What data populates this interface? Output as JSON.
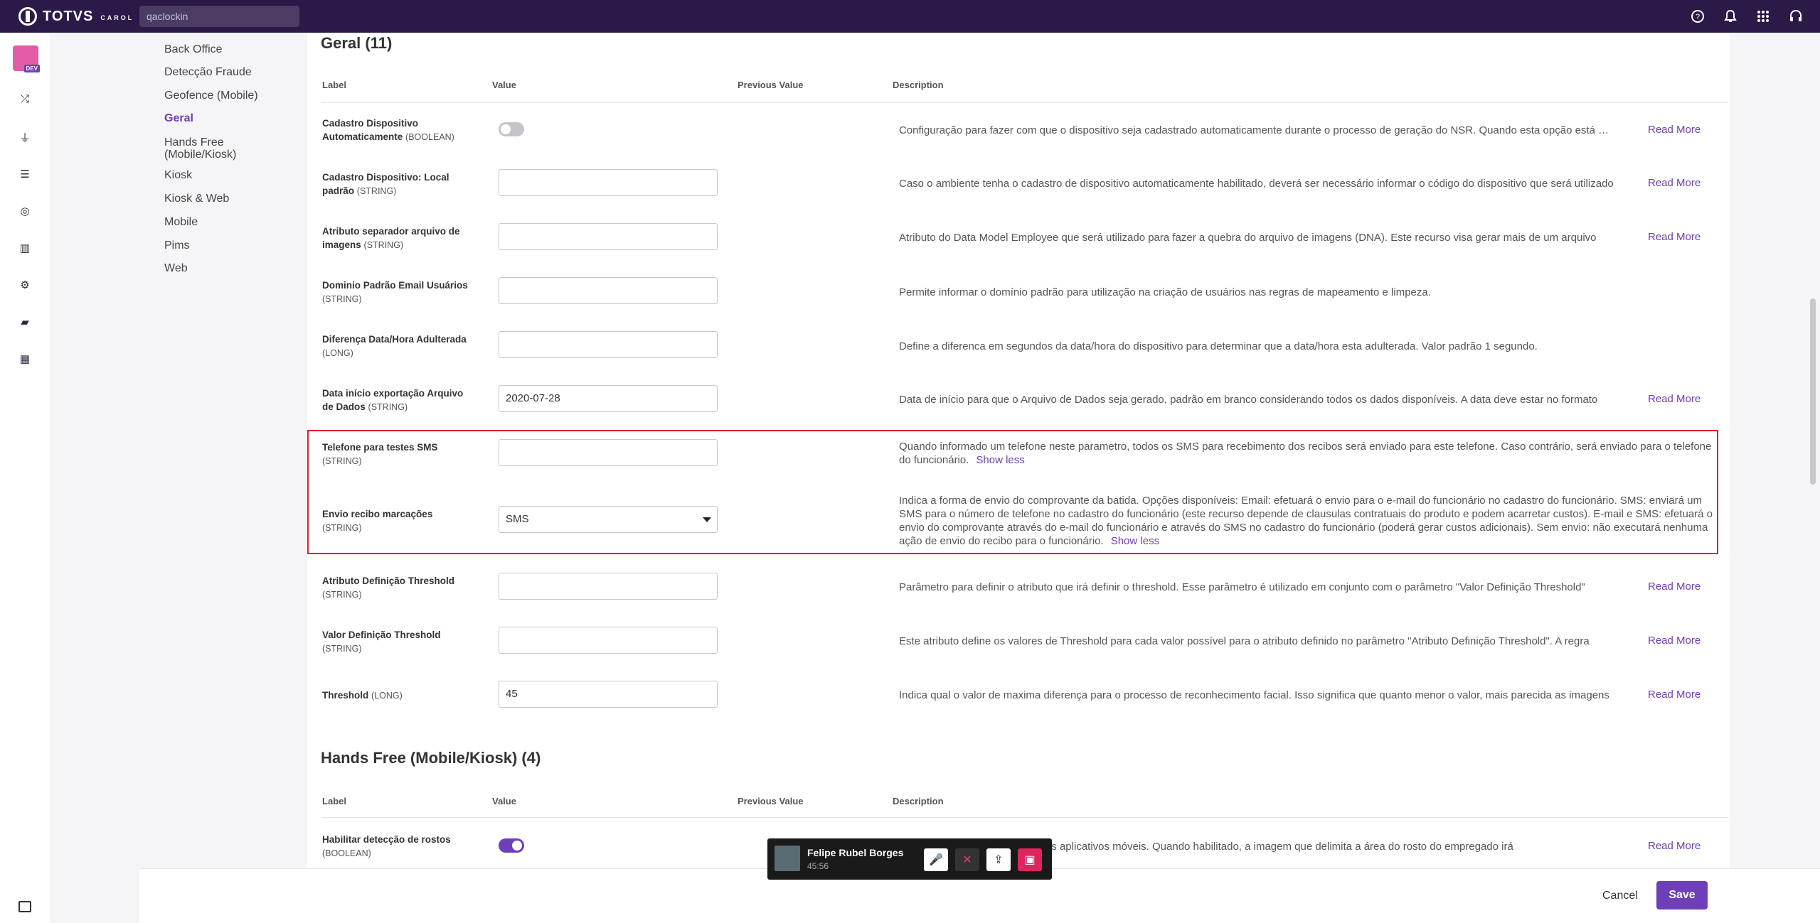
{
  "header": {
    "brand": "TOTVS",
    "brand_sub": "CAROL",
    "search_value": "qaclockin"
  },
  "rail": {
    "badge": "DEV"
  },
  "subnav": {
    "items": [
      {
        "label": "Back Office"
      },
      {
        "label": "Detecção Fraude"
      },
      {
        "label": "Geofence (Mobile)"
      },
      {
        "label": "Geral"
      },
      {
        "label": "Hands Free\n(Mobile/Kiosk)"
      },
      {
        "label": "Kiosk"
      },
      {
        "label": "Kiosk & Web"
      },
      {
        "label": "Mobile"
      },
      {
        "label": "Pims"
      },
      {
        "label": "Web"
      }
    ]
  },
  "table_headers": {
    "label": "Label",
    "value": "Value",
    "previous": "Previous Value",
    "description": "Description"
  },
  "geral": {
    "title": "Geral (11)",
    "rows": [
      {
        "label": "Cadastro Dispositivo Automaticamente",
        "type": "(BOOLEAN)",
        "value": "",
        "desc": "Configuração para fazer com que o dispositivo seja cadastrado automaticamente durante o processo de geração do NSR. Quando esta opção está habilitada",
        "action": "Read More"
      },
      {
        "label": "Cadastro Dispositivo: Local padrão",
        "type": "(STRING)",
        "value": "",
        "desc": "Caso o ambiente tenha o cadastro de dispositivo automaticamente habilitado, deverá ser necessário informar o código do dispositivo que será utilizado",
        "action": "Read More"
      },
      {
        "label": "Atributo separador arquivo de imagens",
        "type": "(STRING)",
        "value": "",
        "desc": "Atributo do Data Model Employee que será utilizado para fazer a quebra do arquivo de imagens (DNA). Este recurso visa gerar mais de um arquivo",
        "action": "Read More"
      },
      {
        "label": "Dominio Padrão Email Usuários",
        "type": "(STRING)",
        "value": "",
        "desc": "Permite informar o domínio padrão para utilização na criação de usuários nas regras de mapeamento e limpeza.",
        "action": ""
      },
      {
        "label": "Diferença Data/Hora Adulterada",
        "type": "(LONG)",
        "value": "",
        "desc": "Define a diferenca em segundos da data/hora do dispositivo para determinar que a data/hora esta adulterada. Valor padrão 1 segundo.",
        "action": ""
      },
      {
        "label": "Data início exportação Arquivo de Dados",
        "type": "(STRING)",
        "value": "2020-07-28",
        "desc": "Data de início para que o Arquivo de Dados seja gerado, padrão em branco considerando todos os dados disponíveis. A data deve estar no formato",
        "action": "Read More"
      },
      {
        "label": "Telefone para testes SMS",
        "type": "(STRING)",
        "value": "",
        "desc": "Quando informado um telefone neste parametro, todos os SMS para recebimento dos recibos será enviado para este telefone. Caso contrário, será enviado para o telefone do funcionário.",
        "action": "Show less"
      },
      {
        "label": "Envio recibo marcações",
        "type": "(STRING)",
        "value": "SMS",
        "desc": "Indica a forma de envio do comprovante da batida. Opções disponíveis: Email: efetuará o envio para o e-mail do funcionário no cadastro do funcionário. SMS: enviará um SMS para o número de telefone no cadastro do funcionário (este recurso depende de clausulas contratuais do produto e podem acarretar custos). E-mail e SMS: efetuará o envio do comprovante através do e-mail do funcionário e através do SMS no cadastro do funcionário (poderá gerar custos adicionais). Sem envio: não executará nenhuma ação de envio do recibo para o funcionário.",
        "action": "Show less"
      },
      {
        "label": "Atributo Definição Threshold",
        "type": "(STRING)",
        "value": "",
        "desc": "Parâmetro para definir o atributo que irá definir o threshold. Esse parâmetro é utilizado em conjunto com o parâmetro \"Valor Definição Threshold\"",
        "action": "Read More"
      },
      {
        "label": "Valor Definição Threshold",
        "type": "(STRING)",
        "value": "",
        "desc": "Este atributo define os valores de Threshold para cada valor possível para o atributo definido no parâmetro \"Atributo Definição Threshold\". A regra",
        "action": "Read More"
      },
      {
        "label": "Threshold",
        "type": "(LONG)",
        "value": "45",
        "desc": "Indica qual o valor de maxima diferença para o processo de reconhecimento facial. Isso significa que quanto menor o valor, mais parecida as imagens",
        "action": "Read More"
      }
    ]
  },
  "hands_free": {
    "title": "Hands Free (Mobile/Kiosk) (4)",
    "rows": [
      {
        "label": "Habilitar detecção de rostos",
        "type": "(BOOLEAN)",
        "desc": "Habilita a detecção de rostos nos aplicativos móveis. Quando habilitado, a imagem que delimita a área do rosto do empregado irá",
        "action": "Read More"
      }
    ]
  },
  "call": {
    "name": "Felipe Rubel Borges",
    "time": "45:56"
  },
  "footer": {
    "cancel": "Cancel",
    "save": "Save"
  },
  "colors": {
    "accent": "#6e3fb8",
    "topbar": "#2b1a48",
    "highlight": "#e01e2a"
  }
}
